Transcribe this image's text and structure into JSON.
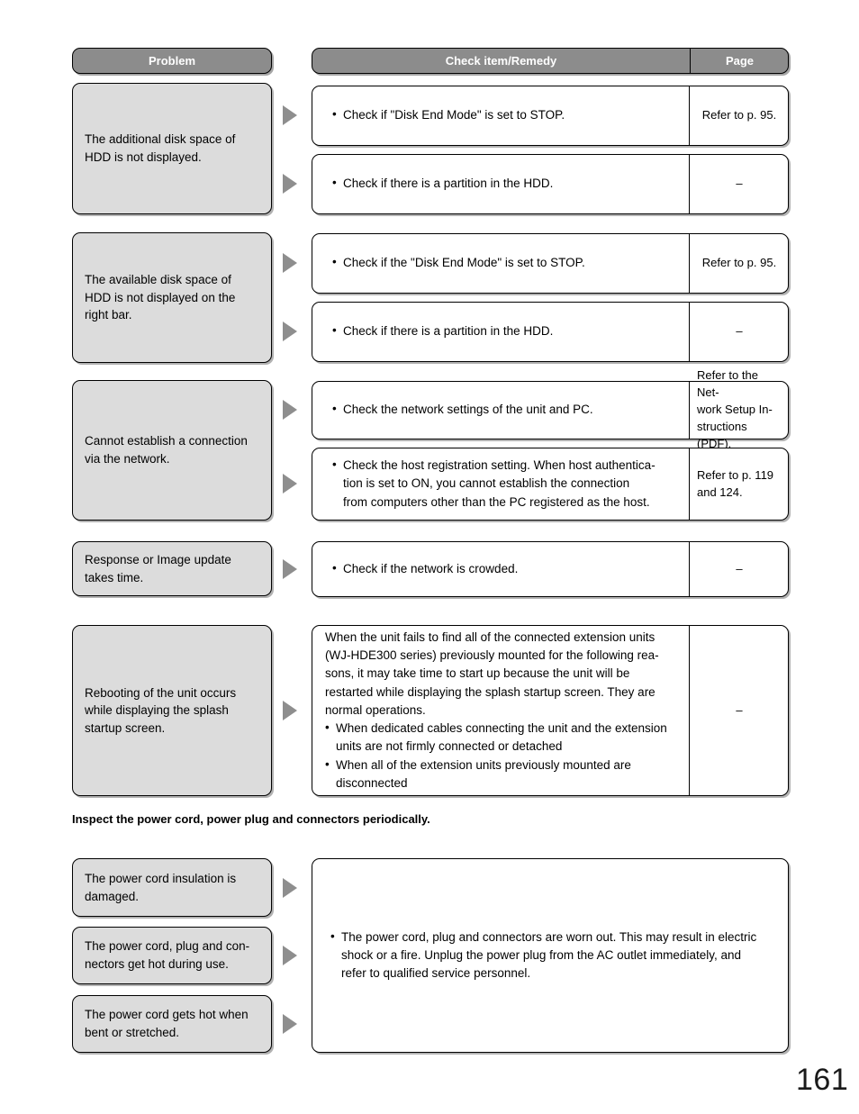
{
  "page_number": "161",
  "table_header": {
    "problem": "Problem",
    "check_item": "Check item/Remedy",
    "page": "Page"
  },
  "section_heading": "Inspect the power cord, power plug and connectors periodically.",
  "rows": [
    {
      "problem": "The additional disk space of HDD is not displayed.",
      "remedies": [
        {
          "text": "Check if \"Disk End Mode\" is set to STOP.",
          "page": "Refer to p. 95."
        },
        {
          "text": "Check if there is a partition in the HDD.",
          "page": "–"
        }
      ]
    },
    {
      "problem": "The available disk space of HDD is not displayed on the right bar.",
      "remedies": [
        {
          "text": "Check if the \"Disk End Mode\" is set to STOP.",
          "page": "Refer to p. 95."
        },
        {
          "text": "Check if there is a partition in the HDD.",
          "page": "–"
        }
      ]
    },
    {
      "problem": "Cannot establish a connection via the network.",
      "remedies": [
        {
          "text": "Check the network settings of the unit and PC.",
          "page": "Refer to the Net-\nwork Setup In-\nstructions (PDF)."
        },
        {
          "text": "Check the host registration setting. When host authentica-\ntion is set to ON, you cannot establish the connection\nfrom computers other than the PC registered as the host.",
          "page": "Refer to p. 119\nand 124."
        }
      ]
    },
    {
      "problem": "Response or Image update takes time.",
      "remedies": [
        {
          "text": "Check if the network is crowded.",
          "page": "–"
        }
      ]
    },
    {
      "problem": "Rebooting of the unit occurs while displaying the splash startup screen.",
      "remedies": [
        {
          "paragraph": "When the unit fails to find all of the connected extension units (WJ-HDE300 series) previously mounted for the following reasons, it may take time to start up because the unit will be restarted while displaying the splash startup screen. They are normal operations.",
          "bullets": [
            "When dedicated cables connecting the unit and the extension units are not firmly connected or detached",
            "When all of the extension units previously mounted are disconnected"
          ],
          "page": "–"
        }
      ]
    }
  ],
  "power_section": {
    "problems": [
      "The power cord insulation is damaged.",
      "The power cord, plug and con-nectors get hot during use.",
      "The power cord gets hot when bent or stretched."
    ],
    "remedy": "The power cord, plug and connectors are worn out. This may result in electric shock or a fire. Unplug the power plug from the AC outlet immediately, and refer to qualified service personnel."
  },
  "lines": {
    "r1_problem_l1": "The additional disk space of",
    "r1_problem_l2": "HDD is not displayed.",
    "r2_problem_l1": "The available disk space of",
    "r2_problem_l2": "HDD is not displayed on the",
    "r2_problem_l3": "right bar.",
    "r3_problem_l1": "Cannot establish a connection",
    "r3_problem_l2": "via the network.",
    "r4_problem_l1": "Response or Image update",
    "r4_problem_l2": "takes time.",
    "r5_problem_l1": "Rebooting of the unit occurs",
    "r5_problem_l2": "while displaying the splash",
    "r5_problem_l3": "startup screen.",
    "r3_rem2_l1": "Check the host registration setting. When host authentica-",
    "r3_rem2_l2": "tion is set to ON, you cannot establish the connection",
    "r3_rem2_l3": "from computers other than the PC registered as the host.",
    "r5_para_l1": "When the unit fails to find all of the connected extension units",
    "r5_para_l2": "(WJ-HDE300 series) previously mounted for the following rea-",
    "r5_para_l3": "sons, it may take time to start up because the unit will be",
    "r5_para_l4": "restarted while displaying the splash startup screen. They are",
    "r5_para_l5": "normal operations.",
    "r5_b1_l1": "When dedicated cables connecting the unit and the extension",
    "r5_b1_l2": "units are not firmly connected or detached",
    "r5_b2_l1": "When all of the extension units previously mounted are",
    "r5_b2_l2": "disconnected",
    "pwr_p1_l1": "The power cord insulation is",
    "pwr_p1_l2": "damaged.",
    "pwr_p2_l1": "The power cord, plug and con-",
    "pwr_p2_l2": "nectors get hot during use.",
    "pwr_p3_l1": "The power cord gets hot when",
    "pwr_p3_l2": "bent or stretched.",
    "pwr_rem_l1": "The power cord, plug and connectors are worn out. This may result in electric",
    "pwr_rem_l2": "shock or a fire. Unplug the power plug from the AC outlet immediately, and",
    "pwr_rem_l3": "refer to qualified service personnel.",
    "pg_net_l1": "Refer to the Net-",
    "pg_net_l2": "work Setup In-",
    "pg_net_l3": "structions (PDF).",
    "pg_119_l1": "Refer to p. 119",
    "pg_119_l2": "and 124."
  }
}
